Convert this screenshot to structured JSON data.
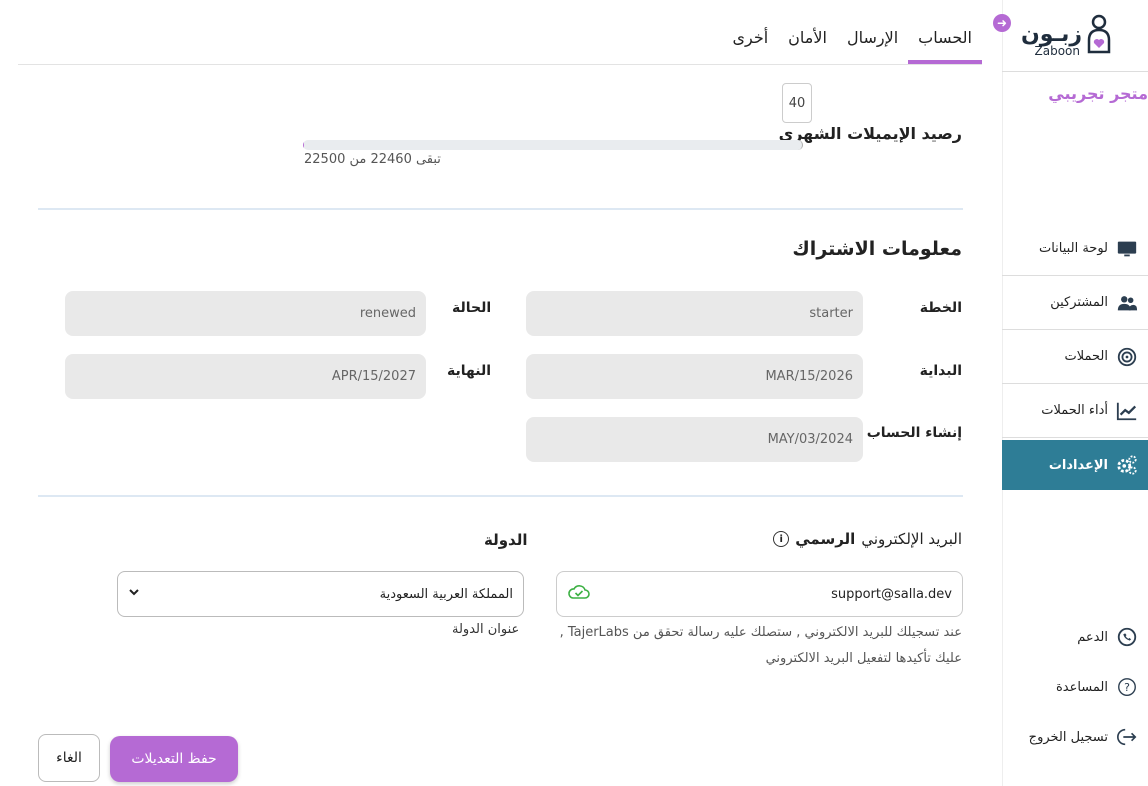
{
  "brand": {
    "name_ar": "زبـون",
    "name_en": "Zaboon",
    "color": "#b56ad4"
  },
  "sidebar": {
    "store_name": "متجر تجريبي",
    "items": [
      {
        "label": "لوحة البيانات",
        "icon": "monitor-icon"
      },
      {
        "label": "المشتركين",
        "icon": "users-icon"
      },
      {
        "label": "الحملات",
        "icon": "campaign-icon"
      },
      {
        "label": "أداء الحملات",
        "icon": "chart-line-icon"
      },
      {
        "label": "الإعدادات",
        "icon": "gears-icon",
        "active": true
      }
    ],
    "bottom_items": [
      {
        "label": "الدعم",
        "icon": "whatsapp-icon"
      },
      {
        "label": "المساعدة",
        "icon": "help-icon"
      },
      {
        "label": "تسجيل الخروج",
        "icon": "logout-icon"
      }
    ]
  },
  "tabs": [
    {
      "label": "الحساب",
      "active": true
    },
    {
      "label": "الإرسال"
    },
    {
      "label": "الأمان"
    },
    {
      "label": "أخرى"
    }
  ],
  "balance": {
    "title": "رصيد الإيميلات الشهري",
    "badge": "40",
    "remaining_text": "تبقى 22460 من 22500",
    "used_fraction": 0.0018
  },
  "subscription": {
    "title": "معلومات الاشتراك",
    "plan": {
      "label": "الخطة",
      "value": "starter"
    },
    "status": {
      "label": "الحالة",
      "value": "renewed"
    },
    "start": {
      "label": "البداية",
      "value": "MAR/15/2026"
    },
    "end": {
      "label": "النهاية",
      "value": "APR/15/2027"
    },
    "created": {
      "label": "إنشاء الحساب",
      "value": "MAY/03/2024"
    }
  },
  "email": {
    "label_prefix": "البريد الإلكتروني",
    "label_bold": "الرسمي",
    "value": "support@salla.dev",
    "note": "عند تسجيلك للبريد الالكتروني , ستصلك عليه رسالة تحقق من TajerLabs , عليك تأكيدها لتفعيل البريد الالكتروني"
  },
  "country": {
    "label": "الدولة",
    "selected": "المملكة العربية السعودية",
    "hint": "عنوان الدولة"
  },
  "actions": {
    "save": "حفظ التعديلات",
    "cancel": "الغاء"
  }
}
